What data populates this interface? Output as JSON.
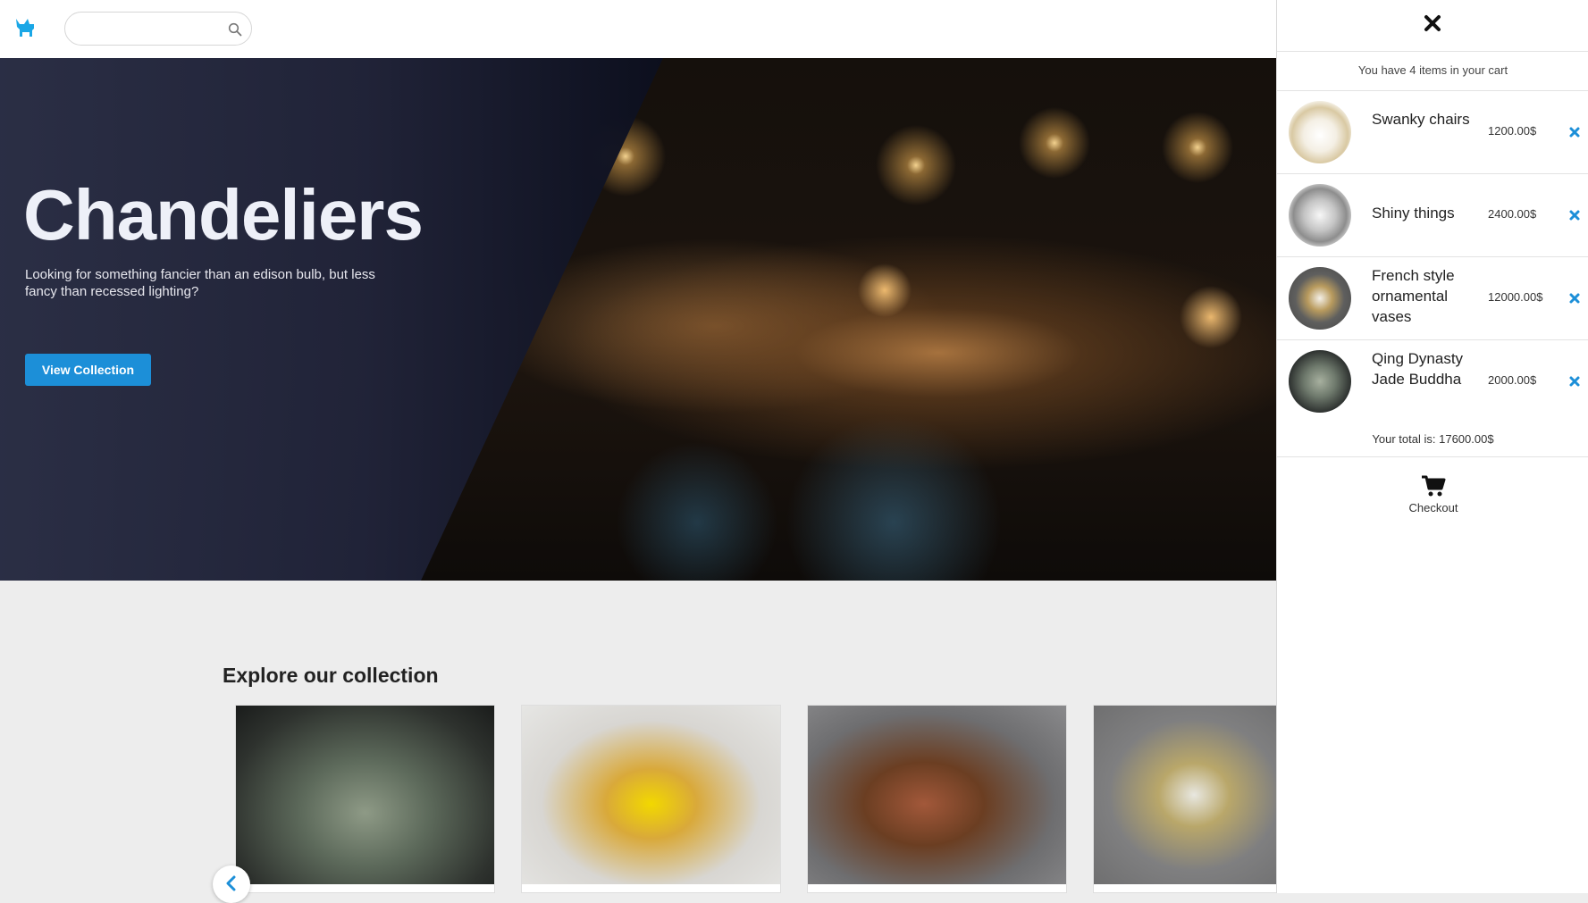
{
  "header": {
    "logo_icon": "cat-icon",
    "search": {
      "value": "",
      "placeholder": "",
      "icon": "search-icon"
    }
  },
  "hero": {
    "title": "Chandeliers",
    "subtitle": "Looking for something fancier than an edison bulb, but less fancy than recessed lighting?",
    "button_label": "View Collection",
    "colors": {
      "overlay": "#262a3f",
      "button": "#1c8fd8"
    }
  },
  "collection": {
    "title": "Explore our collection",
    "prev_icon": "chevron-left-icon"
  },
  "cart": {
    "close_icon": "close-icon",
    "count_text": "You have 4 items in your cart",
    "items": [
      {
        "name": "Swanky chairs",
        "price": "1200.00$"
      },
      {
        "name": "Shiny things",
        "price": "2400.00$"
      },
      {
        "name": "French style ornamental vases",
        "price": "12000.00$"
      },
      {
        "name": "Qing Dynasty Jade Buddha",
        "price": "2000.00$"
      }
    ],
    "remove_icon": "remove-icon",
    "total_label": "Your total is:",
    "total_value": "17600.00$",
    "checkout_label": "Checkout",
    "checkout_icon": "cart-icon",
    "accent_color": "#1c8fd8"
  }
}
